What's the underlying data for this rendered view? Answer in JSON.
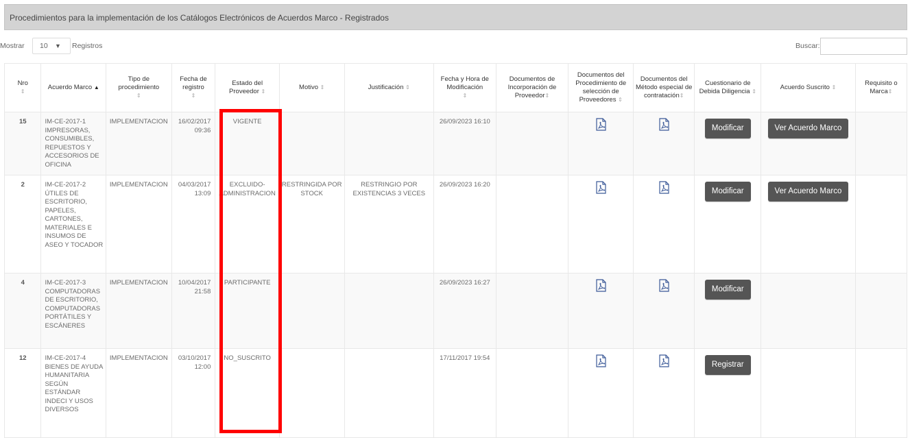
{
  "panel": {
    "title": "Procedimientos para la implementación de los Catálogos Electrónicos de Acuerdos Marco - Registrados"
  },
  "controls": {
    "show_label": "Mostrar",
    "page_size": "10",
    "records_label": "Registros",
    "search_label": "Buscar:",
    "search_value": ""
  },
  "columns": [
    "Nro",
    "Acuerdo Marco",
    "Tipo de procedimiento",
    "Fecha de registro",
    "Estado del Proveedor",
    "Motivo",
    "Justificación",
    "Fecha y Hora de Modificación",
    "Documentos de Incorporación de Proveedor",
    "Documentos del Procedimiento de selección de Proveedores",
    "Documentos del Método especial de contratación",
    "Cuestionario de Debida Diligencia",
    "Acuerdo Suscrito",
    "Requisito o Marca"
  ],
  "rows": [
    {
      "nro": "15",
      "acuerdo": "IM-CE-2017-1 IMPRESORAS, CONSUMIBLES, REPUESTOS Y ACCESORIOS DE OFICINA",
      "tipo": "IMPLEMENTACION",
      "fecha_registro": "16/02/2017 09:36",
      "estado": "VIGENTE",
      "motivo": "",
      "justificacion": "",
      "fecha_mod": "26/09/2023 16:10",
      "doc_incorporacion": "",
      "has_doc_procedimiento": true,
      "has_doc_metodo": true,
      "cuestionario_btn": "Modificar",
      "acuerdo_btn": "Ver Acuerdo Marco",
      "requisito": ""
    },
    {
      "nro": "2",
      "acuerdo": "IM-CE-2017-2 ÚTILES DE ESCRITORIO, PAPELES, CARTONES, MATERIALES E INSUMOS DE ASEO Y TOCADOR",
      "tipo": "IMPLEMENTACION",
      "fecha_registro": "04/03/2017 13:09",
      "estado": "EXCLUIDO-ADMINISTRACION",
      "motivo": "RESTRINGIDA POR STOCK",
      "justificacion": "RESTRINGIO POR EXISTENCIAS 3 VECES",
      "fecha_mod": "26/09/2023 16:20",
      "doc_incorporacion": "",
      "has_doc_procedimiento": true,
      "has_doc_metodo": true,
      "cuestionario_btn": "Modificar",
      "acuerdo_btn": "Ver Acuerdo Marco",
      "requisito": ""
    },
    {
      "nro": "4",
      "acuerdo": "IM-CE-2017-3 COMPUTADORAS DE ESCRITORIO, COMPUTADORAS PORTÁTILES Y ESCÁNERES",
      "tipo": "IMPLEMENTACION",
      "fecha_registro": "10/04/2017 21:58",
      "estado": "PARTICIPANTE",
      "motivo": "",
      "justificacion": "",
      "fecha_mod": "26/09/2023 16:27",
      "doc_incorporacion": "",
      "has_doc_procedimiento": true,
      "has_doc_metodo": true,
      "cuestionario_btn": "Modificar",
      "acuerdo_btn": "",
      "requisito": ""
    },
    {
      "nro": "12",
      "acuerdo": "IM-CE-2017-4 BIENES DE AYUDA HUMANITARIA SEGÚN ESTÁNDAR INDECI Y USOS DIVERSOS",
      "tipo": "IMPLEMENTACION",
      "fecha_registro": "03/10/2017 12:00",
      "estado": "NO_SUSCRITO",
      "motivo": "",
      "justificacion": "",
      "fecha_mod": "17/11/2017 19:54",
      "doc_incorporacion": "",
      "has_doc_procedimiento": true,
      "has_doc_metodo": true,
      "cuestionario_btn": "Registrar",
      "acuerdo_btn": "",
      "requisito": ""
    }
  ],
  "colors": {
    "highlight": "#ff0000",
    "button_bg": "#555555",
    "header_bg": "#d3d3d3",
    "pdf_icon": "#3b5998"
  }
}
